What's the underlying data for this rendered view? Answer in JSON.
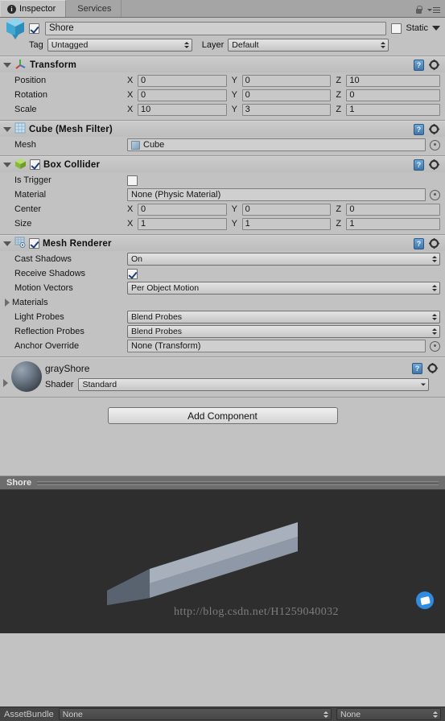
{
  "window": {
    "tabs": [
      {
        "label": "Inspector",
        "active": true,
        "icon": "inspector-icon"
      },
      {
        "label": "Services",
        "active": false,
        "icon": "services-icon"
      }
    ],
    "lock_icon": "lock-icon",
    "menu_icon": "menu-icon"
  },
  "object_header": {
    "icon": "cube-prefab-icon",
    "enabled": true,
    "name": "Shore",
    "name_placeholder": "Name",
    "static_label": "Static",
    "static_checked": false,
    "tag_label": "Tag",
    "tag_value": "Untagged",
    "layer_label": "Layer",
    "layer_value": "Default"
  },
  "components": [
    {
      "id": "transform",
      "title": "Transform",
      "icon": "transform-axis-icon",
      "expanded": true,
      "has_enable_toggle": false,
      "rows": [
        {
          "kind": "vector3",
          "label": "Position",
          "axes": [
            "X",
            "Y",
            "Z"
          ],
          "values": [
            "0",
            "0",
            "10"
          ]
        },
        {
          "kind": "vector3",
          "label": "Rotation",
          "axes": [
            "X",
            "Y",
            "Z"
          ],
          "values": [
            "0",
            "0",
            "0"
          ]
        },
        {
          "kind": "vector3",
          "label": "Scale",
          "axes": [
            "X",
            "Y",
            "Z"
          ],
          "values": [
            "10",
            "3",
            "1"
          ]
        }
      ]
    },
    {
      "id": "mesh-filter",
      "title": "Cube (Mesh Filter)",
      "icon": "mesh-filter-icon",
      "expanded": true,
      "has_enable_toggle": false,
      "rows": [
        {
          "kind": "object",
          "label": "Mesh",
          "value": "Cube",
          "value_icon": "mesh-icon"
        }
      ]
    },
    {
      "id": "box-collider",
      "title": "Box Collider",
      "icon": "box-collider-icon",
      "expanded": true,
      "has_enable_toggle": true,
      "enabled": true,
      "rows": [
        {
          "kind": "checkbox",
          "label": "Is Trigger",
          "checked": false
        },
        {
          "kind": "object",
          "label": "Material",
          "value": "None (Physic Material)",
          "value_icon": null
        },
        {
          "kind": "vector3",
          "label": "Center",
          "axes": [
            "X",
            "Y",
            "Z"
          ],
          "values": [
            "0",
            "0",
            "0"
          ]
        },
        {
          "kind": "vector3",
          "label": "Size",
          "axes": [
            "X",
            "Y",
            "Z"
          ],
          "values": [
            "1",
            "1",
            "1"
          ]
        }
      ]
    },
    {
      "id": "mesh-renderer",
      "title": "Mesh Renderer",
      "icon": "mesh-renderer-icon",
      "expanded": true,
      "has_enable_toggle": true,
      "enabled": true,
      "rows": [
        {
          "kind": "popup",
          "label": "Cast Shadows",
          "value": "On"
        },
        {
          "kind": "checkbox",
          "label": "Receive Shadows",
          "checked": true
        },
        {
          "kind": "popup",
          "label": "Motion Vectors",
          "value": "Per Object Motion"
        },
        {
          "kind": "foldout",
          "label": "Materials",
          "expanded": false
        },
        {
          "kind": "popup",
          "label": "Light Probes",
          "value": "Blend Probes"
        },
        {
          "kind": "popup",
          "label": "Reflection Probes",
          "value": "Blend Probes"
        },
        {
          "kind": "object",
          "label": "Anchor Override",
          "value": "None (Transform)",
          "value_icon": null
        }
      ]
    }
  ],
  "material_block": {
    "icon": "material-sphere-icon",
    "name": "grayShore",
    "shader_label": "Shader",
    "shader_value": "Standard",
    "expanded": false
  },
  "add_component": {
    "label": "Add Component"
  },
  "preview": {
    "title": "Shore",
    "watermark": "http://blog.csdn.net/H1259040032",
    "badge_icon": "csdn-badge-icon"
  },
  "bottom_bar": {
    "label": "AssetBundle",
    "bundle_value": "None",
    "variant_value": "None"
  },
  "colors": {
    "panel": "#c2c2c2",
    "tabbar": "#a5a5a5",
    "preview_bg": "#2e2e2e",
    "preview_header": "#6d6d6d",
    "bottom_bar": "#454545",
    "checkbox_check": "#1b3f7a"
  }
}
